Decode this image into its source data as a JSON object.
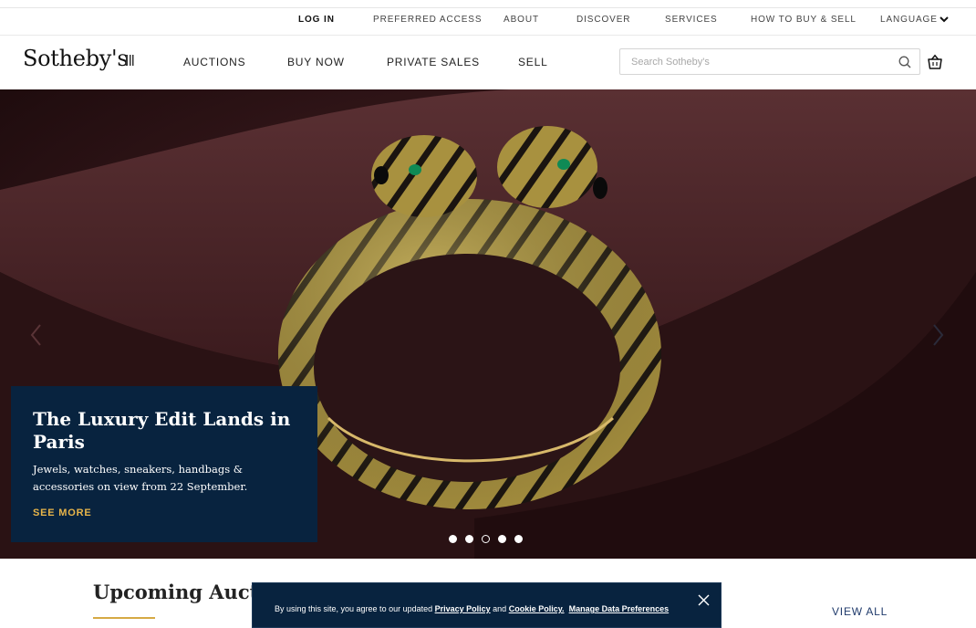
{
  "utility_nav": {
    "login": "LOG IN",
    "items": [
      "PREFERRED ACCESS",
      "ABOUT",
      "DISCOVER",
      "SERVICES",
      "HOW TO BUY & SELL"
    ],
    "language": "LANGUAGE"
  },
  "header": {
    "logo": "Sotheby's",
    "nav": [
      "AUCTIONS",
      "BUY NOW",
      "PRIVATE SALES",
      "SELL"
    ],
    "search_placeholder": "Search Sotheby's"
  },
  "hero": {
    "title": "The Luxury Edit Lands in Paris",
    "description": "Jewels, watches, sneakers, handbags & accessories on view from 22 September.",
    "cta": "SEE MORE",
    "slide_count": 5,
    "active_slide": 3
  },
  "upcoming": {
    "title": "Upcoming Auctions",
    "view_all": "VIEW ALL"
  },
  "cookie_banner": {
    "prefix": "By using this site, you agree to our updated ",
    "privacy_link": "Privacy Policy",
    "and": " and ",
    "cookie_link": "Cookie Policy.",
    "manage_link": "Manage Data Preferences"
  },
  "colors": {
    "navy": "#08233f",
    "gold": "#e8b54a",
    "hero_bg": "#2c1416"
  }
}
